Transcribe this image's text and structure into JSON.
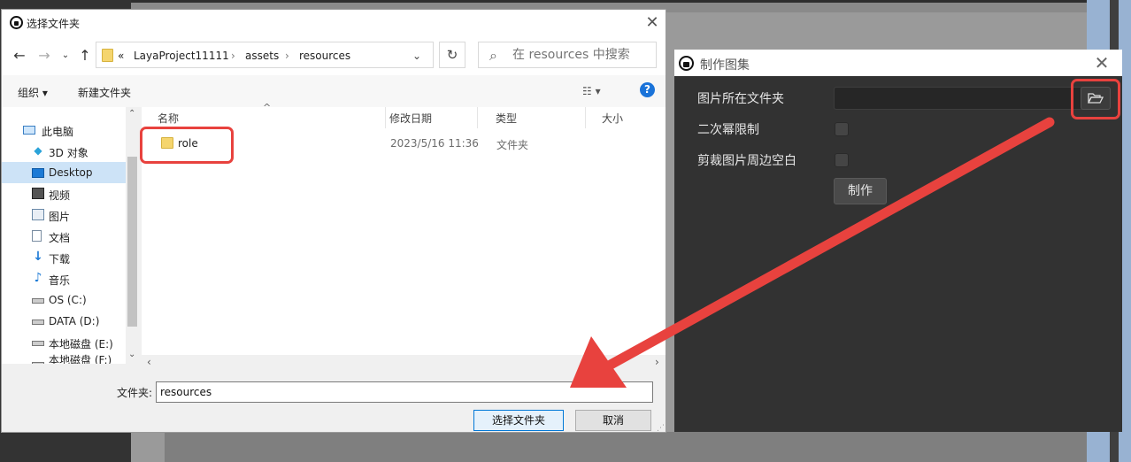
{
  "file_dialog": {
    "title": "选择文件夹",
    "breadcrumb": [
      "LayaProject11111",
      "assets",
      "resources"
    ],
    "breadcrumb_prefix": "«",
    "search_placeholder": "在 resources 中搜索",
    "toolbar": {
      "organize": "组织 ▾",
      "new_folder": "新建文件夹"
    },
    "nav_tree": [
      {
        "label": "此电脑",
        "icon": "computer-icon"
      },
      {
        "label": "3D 对象",
        "icon": "3d-objects-icon"
      },
      {
        "label": "Desktop",
        "icon": "desktop-icon",
        "selected": true
      },
      {
        "label": "视频",
        "icon": "videos-icon"
      },
      {
        "label": "图片",
        "icon": "pictures-icon"
      },
      {
        "label": "文档",
        "icon": "documents-icon"
      },
      {
        "label": "下载",
        "icon": "downloads-icon"
      },
      {
        "label": "音乐",
        "icon": "music-icon"
      },
      {
        "label": "OS (C:)",
        "icon": "drive-icon"
      },
      {
        "label": "DATA (D:)",
        "icon": "drive-icon"
      },
      {
        "label": "本地磁盘 (E:)",
        "icon": "drive-icon"
      },
      {
        "label": "本地磁盘 (F:)",
        "icon": "drive-icon"
      }
    ],
    "columns": [
      "名称",
      "修改日期",
      "类型",
      "大小"
    ],
    "files": [
      {
        "name": "role",
        "modified": "2023/5/16 11:36",
        "type": "文件夹",
        "size": ""
      }
    ],
    "folder_label": "文件夹:",
    "folder_value": "resources",
    "select_button": "选择文件夹",
    "cancel_button": "取消"
  },
  "atlas_panel": {
    "title": "制作图集",
    "fields": [
      {
        "label": "图片所在文件夹",
        "kind": "folder-path",
        "value": ""
      },
      {
        "label": "二次幂限制",
        "kind": "checkbox",
        "checked": false
      },
      {
        "label": "剪裁图片周边空白",
        "kind": "checkbox",
        "checked": false
      }
    ],
    "make_button": "制作"
  },
  "annotation_color": "#e8423e"
}
